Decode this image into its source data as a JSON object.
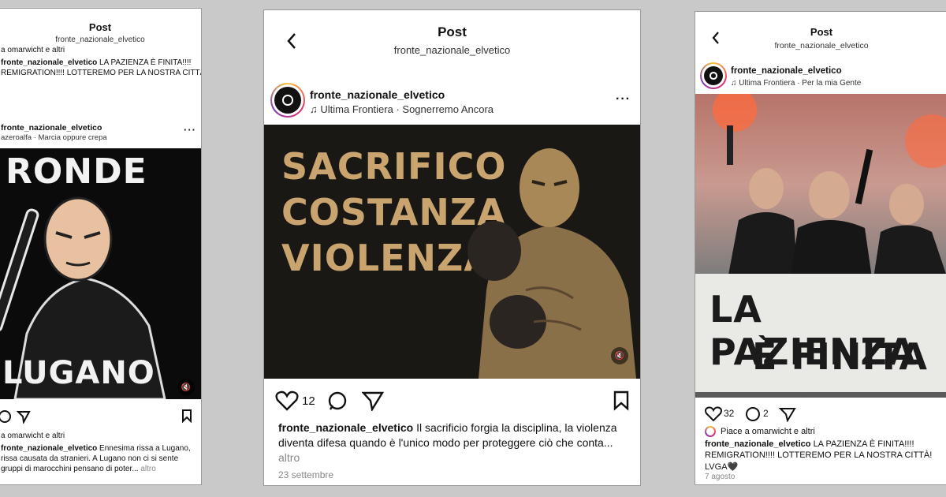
{
  "left": {
    "header_title": "Post",
    "header_sub": "fronte_nazionale_elvetico",
    "liked_by_top": "a omarwicht e altri",
    "prev_user": "fronte_nazionale_elvetico",
    "prev_caption": "LA PAZIENZA È FINITA!!!!",
    "prev_caption2": "REMIGRATION!!!! LOTTEREMO PER LA NOSTRA CITTÀ!! 🖤",
    "username": "fronte_nazionale_elvetico",
    "music": "azeroalfa · Marcia oppure crepa",
    "poster_top": "RONDE",
    "poster_bottom": "LUGANO",
    "liked_by": "a omarwicht e altri",
    "cap_user": "fronte_nazionale_elvetico",
    "caption_l1": "Ennesima rissa a Lugano,",
    "caption_l2": "rissa causata da stranieri. A Lugano non ci si sente",
    "caption_l3": "gruppi di marocchini pensano di poter...",
    "more": "altro"
  },
  "middle": {
    "header_title": "Post",
    "header_sub": "fronte_nazionale_elvetico",
    "username": "fronte_nazionale_elvetico",
    "music": "Ultima Frontiera · Sognerremo Ancora",
    "poster_lines": [
      "SACRIFICO",
      "COSTANZA",
      "VIOLENZA"
    ],
    "likes": "12",
    "cap_user": "fronte_nazionale_elvetico",
    "caption": "Il sacrificio forgia la disciplina, la violenza diventa difesa quando è l'unico modo per proteggere ciò che conta...",
    "more": "altro",
    "date": "23 settembre"
  },
  "right": {
    "header_title": "Post",
    "header_sub": "fronte_nazionale_elvetico",
    "username": "fronte_nazionale_elvetico",
    "music": "Ultima Frontiera · Per la mia Gente",
    "banner_l1": "LA PAZIENZA",
    "banner_l2": "È FINITA",
    "likes": "32",
    "comments": "2",
    "liked_by": "Piace a omarwicht e altri",
    "cap_user": "fronte_nazionale_elvetico",
    "caption_l1": "LA PAZIENZA È FINITA!!!!",
    "caption_l2": "REMIGRATION!!!! LOTTEREMO PER LA NOSTRA CITTÀ!",
    "caption_l3": "LVGA🖤",
    "date": "7 agosto"
  }
}
